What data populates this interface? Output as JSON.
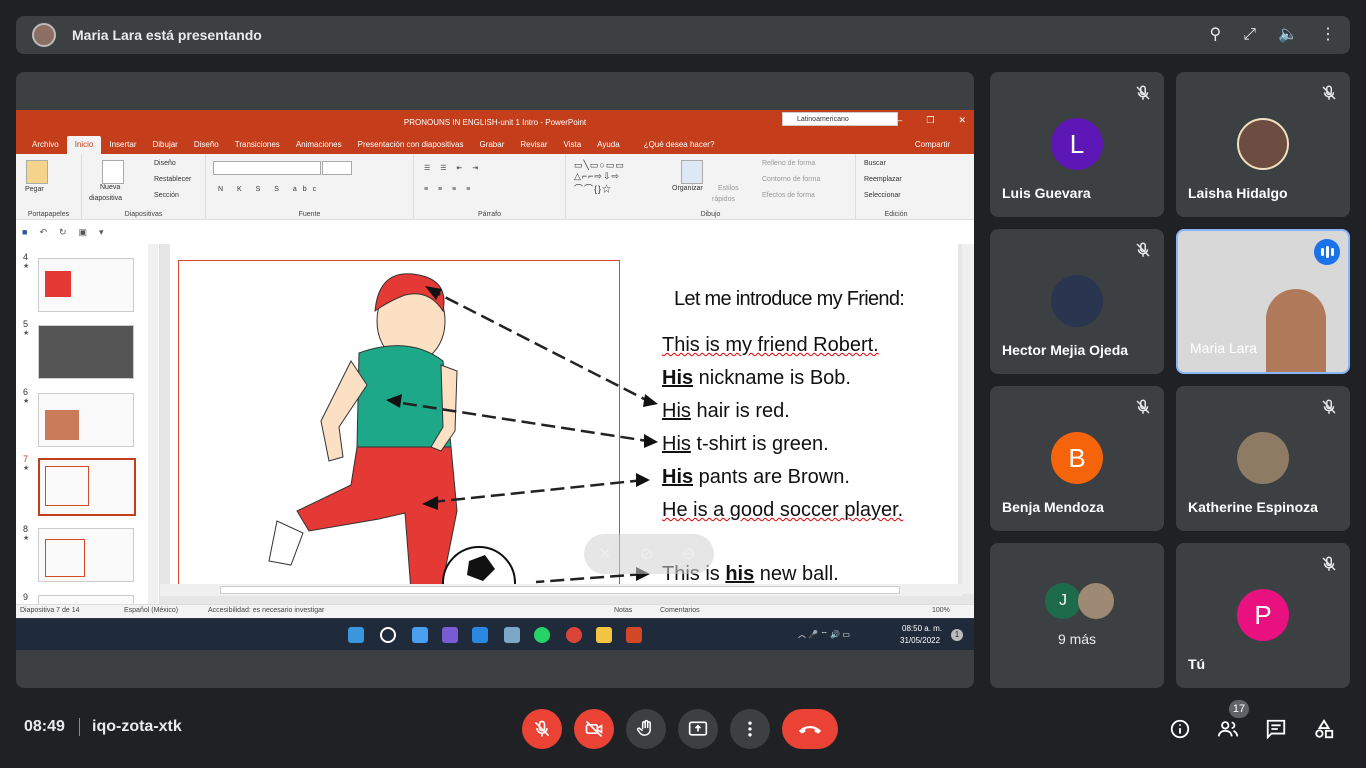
{
  "header": {
    "presenter_text": "Maria Lara está presentando",
    "icons": [
      "pin-icon",
      "fullscreen-icon",
      "volume-icon",
      "more-icon"
    ]
  },
  "powerpoint": {
    "title": "PRONOUNS IN ENGLISH-unit 1 Intro  -  PowerPoint",
    "lang_box": "Latinoamericano",
    "tabs": [
      "Archivo",
      "Inicio",
      "Insertar",
      "Dibujar",
      "Diseño",
      "Transiciones",
      "Animaciones",
      "Presentación con diapositivas",
      "Grabar",
      "Revisar",
      "Vista",
      "Ayuda"
    ],
    "tell_me": "¿Qué desea hacer?",
    "share": "Compartir",
    "ribbon": {
      "paste": "Pegar",
      "portapapeles": "Portapapeles",
      "nueva": "Nueva",
      "diapositiva": "diapositiva",
      "diseno": "Diseño",
      "restablecer": "Restablecer",
      "seccion": "Sección",
      "diapositivas": "Diapositivas",
      "fuente": "Fuente",
      "parrafo": "Párrafo",
      "organizar": "Organizar",
      "estilos": "Estilos",
      "rapidos": "rápidos",
      "relleno": "Relleno de forma",
      "contorno": "Contorno de forma",
      "efectos": "Efectos de forma",
      "dibujo": "Dibujo",
      "buscar": "Buscar",
      "reemplazar": "Reemplazar",
      "seleccionar": "Seleccionar",
      "edicion": "Edición"
    },
    "thumbnails": [
      {
        "num": "4",
        "star": "★"
      },
      {
        "num": "5",
        "star": "★"
      },
      {
        "num": "6",
        "star": "★"
      },
      {
        "num": "7",
        "star": "★"
      },
      {
        "num": "8",
        "star": "★"
      },
      {
        "num": "9",
        "star": ""
      }
    ],
    "slide": {
      "heading": "Let me introduce  my Friend:",
      "l1": "This is my friend Robert.",
      "l2a": "His",
      "l2b": " nickname is Bob.",
      "l3a": "His",
      "l3b": " hair is red.",
      "l4a": "His",
      "l4b": " t-shirt is green.",
      "l5a": "His",
      "l5b": " pants are Brown.",
      "l6": "He is a good soccer player.",
      "l7a": "This is ",
      "l7b": "his",
      "l7c": " new ball."
    },
    "status": {
      "slide": "Diapositiva 7 de 14",
      "lang": "Español (México)",
      "access": "Accesibilidad: es necesario investigar",
      "notes": "Notas",
      "comments": "Comentarios",
      "zoom": "100%"
    },
    "taskbar": {
      "time": "08:50 a. m.",
      "date": "31/05/2022",
      "mail_badge": "1",
      "notif": "1"
    }
  },
  "participants": [
    {
      "name": "Luis Guevara",
      "initial": "L",
      "color": "#5c17b6",
      "muted": true
    },
    {
      "name": "Laisha Hidalgo",
      "muted": true
    },
    {
      "name": "Hector Mejia Ojeda",
      "muted": true
    },
    {
      "name": "Maria Lara",
      "speaking": true
    },
    {
      "name": "Benja Mendoza",
      "initial": "B",
      "color": "#f5640a",
      "muted": true
    },
    {
      "name": "Katherine Espinoza",
      "muted": true
    },
    {
      "more_label": "9 más",
      "initial": "J",
      "color": "#1d6b4a"
    },
    {
      "name": "Tú",
      "initial": "P",
      "color": "#e8117f",
      "muted": true
    }
  ],
  "bottom": {
    "time": "08:49",
    "meeting_code": "iqo-zota-xtk",
    "people_count": "17"
  }
}
